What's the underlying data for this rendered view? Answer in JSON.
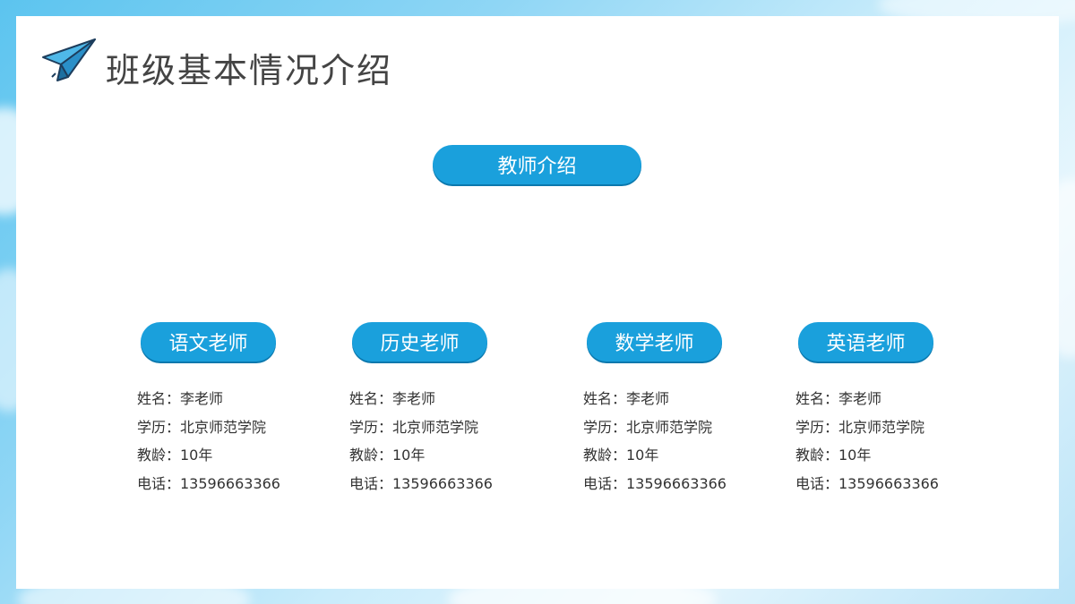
{
  "header": {
    "title": "班级基本情况介绍"
  },
  "section": {
    "label": "教师介绍"
  },
  "teachers": [
    {
      "subject": "语文老师",
      "name_line": "姓名：李老师",
      "edu_line": "学历：北京师范学院",
      "years_line": "教龄：10年",
      "phone_line": "电话：13596663366"
    },
    {
      "subject": "历史老师",
      "name_line": "姓名：李老师",
      "edu_line": "学历：北京师范学院",
      "years_line": "教龄：10年",
      "phone_line": "电话：13596663366"
    },
    {
      "subject": "数学老师",
      "name_line": "姓名：李老师",
      "edu_line": "学历：北京师范学院",
      "years_line": "教龄：10年",
      "phone_line": "电话：13596663366"
    },
    {
      "subject": "英语老师",
      "name_line": "姓名：李老师",
      "edu_line": "学历：北京师范学院",
      "years_line": "教龄：10年",
      "phone_line": "电话：13596663366"
    }
  ],
  "colors": {
    "accent": "#1aa0dc",
    "title_text": "#444444",
    "body_text": "#333333"
  },
  "icons": {
    "title_icon": "paper-plane-icon"
  }
}
